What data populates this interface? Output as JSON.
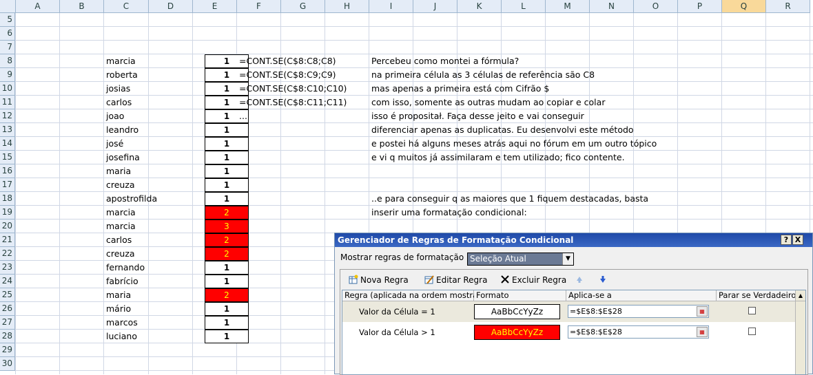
{
  "columns": [
    "A",
    "B",
    "C",
    "D",
    "E",
    "F",
    "G",
    "H",
    "I",
    "J",
    "K",
    "L",
    "M",
    "N",
    "O",
    "P",
    "Q",
    "R"
  ],
  "selected_column": "Q",
  "rows": [
    "5",
    "6",
    "7",
    "8",
    "9",
    "10",
    "11",
    "12",
    "13",
    "14",
    "15",
    "16",
    "17",
    "18",
    "19",
    "20",
    "21",
    "22",
    "23",
    "24",
    "25",
    "26",
    "27",
    "28",
    "29",
    "30"
  ],
  "names": [
    "marcia",
    "roberta",
    "josias",
    "carlos",
    "joao",
    "leandro",
    "josé",
    "josefina",
    "maria",
    "creuza",
    "apostrofilda",
    "marcia",
    "marcia",
    "carlos",
    "creuza",
    "fernando",
    "fabrício",
    "maria",
    "mário",
    "marcos",
    "luciano"
  ],
  "counts": [
    {
      "v": "1",
      "dup": false
    },
    {
      "v": "1",
      "dup": false
    },
    {
      "v": "1",
      "dup": false
    },
    {
      "v": "1",
      "dup": false
    },
    {
      "v": "1",
      "dup": false
    },
    {
      "v": "1",
      "dup": false
    },
    {
      "v": "1",
      "dup": false
    },
    {
      "v": "1",
      "dup": false
    },
    {
      "v": "1",
      "dup": false
    },
    {
      "v": "1",
      "dup": false
    },
    {
      "v": "1",
      "dup": false
    },
    {
      "v": "2",
      "dup": true
    },
    {
      "v": "3",
      "dup": true
    },
    {
      "v": "2",
      "dup": true
    },
    {
      "v": "2",
      "dup": true
    },
    {
      "v": "1",
      "dup": false
    },
    {
      "v": "1",
      "dup": false
    },
    {
      "v": "2",
      "dup": true
    },
    {
      "v": "1",
      "dup": false
    },
    {
      "v": "1",
      "dup": false
    },
    {
      "v": "1",
      "dup": false
    }
  ],
  "formulas": [
    "=CONT.SE(C$8:C8;C8)",
    "=CONT.SE(C$8:C9;C9)",
    "=CONT.SE(C$8:C10;C10)",
    "=CONT.SE(C$8:C11;C11)",
    "..."
  ],
  "notes": [
    {
      "row": 8,
      "text": "Percebeu como montei a fórmula?"
    },
    {
      "row": 9,
      "text": "na primeira célula as 3 células de referência são C8"
    },
    {
      "row": 10,
      "text": "mas apenas a primeira está com Cifrão $"
    },
    {
      "row": 11,
      "text": "com isso, somente as outras mudam ao copiar e colar"
    },
    {
      "row": 12,
      "text": "isso é propositał. Faça desse jeito e vai conseguir"
    },
    {
      "row": 13,
      "text": "diferenciar apenas as duplicatas. Eu desenvolvi este método"
    },
    {
      "row": 14,
      "text": "e postei há alguns meses atrás aqui no fórum em um outro tópico"
    },
    {
      "row": 15,
      "text": "e vi q muitos já assimilaram e tem utilizado; fico contente."
    },
    {
      "row": 18,
      "text": "..e para conseguir q as maiores que 1 fiquem destacadas, basta"
    },
    {
      "row": 19,
      "text": "inserir uma formatação condicional:"
    }
  ],
  "dialog": {
    "title": "Gerenciador de Regras de Formatação Condicional",
    "help_btn": "?",
    "close_btn": "X",
    "show_label": "Mostrar regras de formatação para:",
    "show_value": "Seleção Atual",
    "new_rule": "Nova Regra",
    "edit_rule": "Editar Regra",
    "delete_rule": "Excluir Regra",
    "col_rule": "Regra (aplicada na ordem mostrada)",
    "col_format": "Formato",
    "col_applies": "Aplica-se a",
    "col_stop": "Parar se Verdadeiro",
    "rules": [
      {
        "label": "Valor da Célula = 1",
        "preview": "AaBbCcYyZz",
        "applies": "=$E$8:$E$28",
        "red": false
      },
      {
        "label": "Valor da Célula > 1",
        "preview": "AaBbCcYyZz",
        "applies": "=$E$8:$E$28",
        "red": true
      }
    ]
  }
}
